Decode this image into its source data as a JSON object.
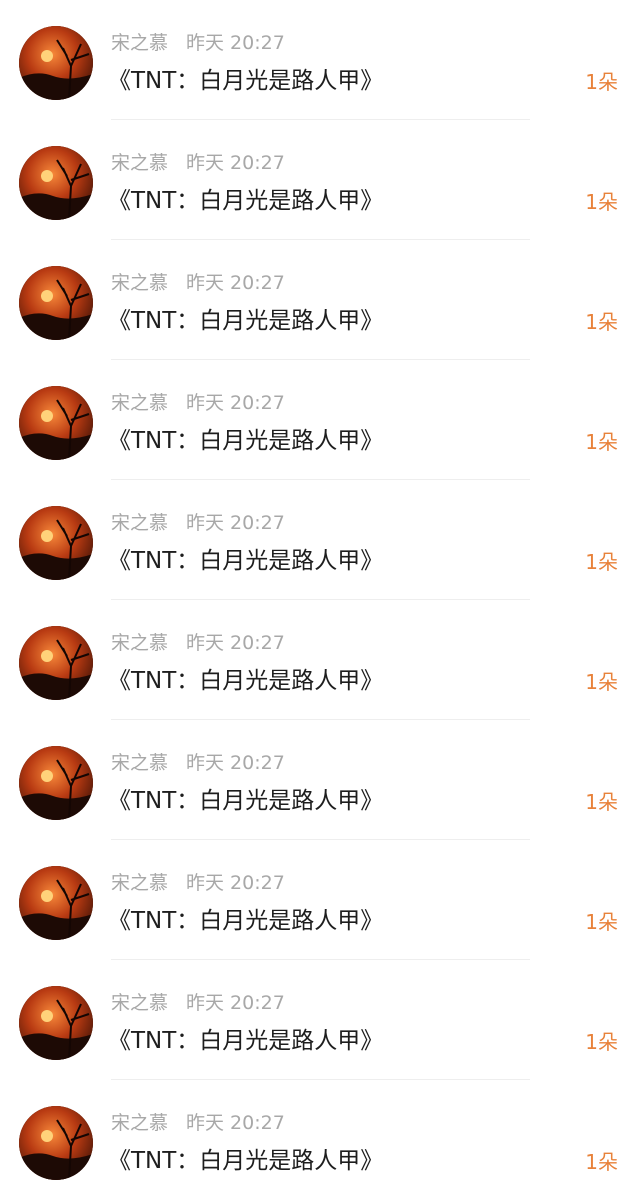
{
  "colors": {
    "background": "#ffffff",
    "meta_text": "#a8a8a8",
    "title_text": "#1e1e1e",
    "count_accent": "#e8823a",
    "divider": "#eeeeee"
  },
  "feed": {
    "items": [
      {
        "author": "宋之慕",
        "time": "昨天 20:27",
        "title": "《TNT：白月光是路人甲》",
        "count": "1朵",
        "avatar_icon": "sunset-tree-avatar"
      },
      {
        "author": "宋之慕",
        "time": "昨天 20:27",
        "title": "《TNT：白月光是路人甲》",
        "count": "1朵",
        "avatar_icon": "sunset-tree-avatar"
      },
      {
        "author": "宋之慕",
        "time": "昨天 20:27",
        "title": "《TNT：白月光是路人甲》",
        "count": "1朵",
        "avatar_icon": "sunset-tree-avatar"
      },
      {
        "author": "宋之慕",
        "time": "昨天 20:27",
        "title": "《TNT：白月光是路人甲》",
        "count": "1朵",
        "avatar_icon": "sunset-tree-avatar"
      },
      {
        "author": "宋之慕",
        "time": "昨天 20:27",
        "title": "《TNT：白月光是路人甲》",
        "count": "1朵",
        "avatar_icon": "sunset-tree-avatar"
      },
      {
        "author": "宋之慕",
        "time": "昨天 20:27",
        "title": "《TNT：白月光是路人甲》",
        "count": "1朵",
        "avatar_icon": "sunset-tree-avatar"
      },
      {
        "author": "宋之慕",
        "time": "昨天 20:27",
        "title": "《TNT：白月光是路人甲》",
        "count": "1朵",
        "avatar_icon": "sunset-tree-avatar"
      },
      {
        "author": "宋之慕",
        "time": "昨天 20:27",
        "title": "《TNT：白月光是路人甲》",
        "count": "1朵",
        "avatar_icon": "sunset-tree-avatar"
      },
      {
        "author": "宋之慕",
        "time": "昨天 20:27",
        "title": "《TNT：白月光是路人甲》",
        "count": "1朵",
        "avatar_icon": "sunset-tree-avatar"
      },
      {
        "author": "宋之慕",
        "time": "昨天 20:27",
        "title": "《TNT：白月光是路人甲》",
        "count": "1朵",
        "avatar_icon": "sunset-tree-avatar"
      }
    ]
  }
}
